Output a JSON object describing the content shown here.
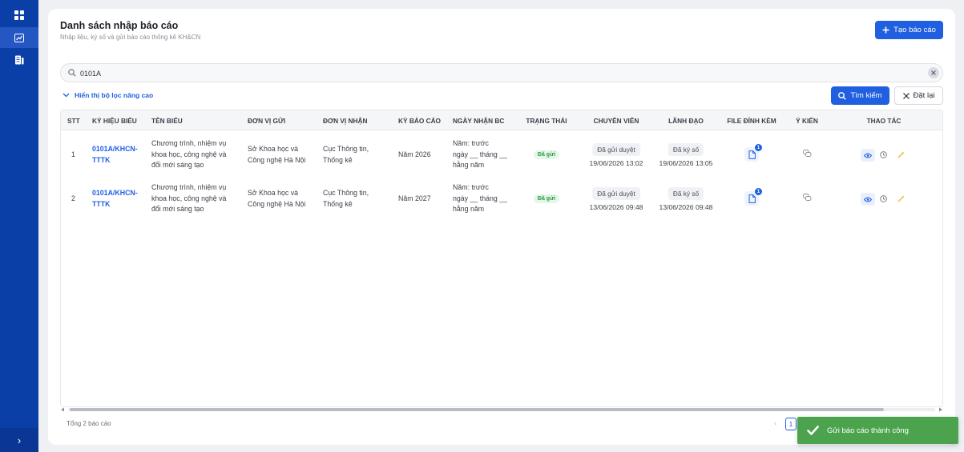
{
  "page": {
    "title": "Danh sách nhập báo cáo",
    "subtitle": "Nhập liệu, ký số và gửi báo cáo thống kê KH&CN",
    "create_label": "Tạo báo cáo"
  },
  "search": {
    "value": "0101A",
    "search_label": "Tìm kiếm",
    "reset_label": "Đặt lại",
    "advanced_label": "Hiển thị bộ lọc nâng cao"
  },
  "table": {
    "headers": [
      "STT",
      "KÝ HIỆU BIỂU",
      "TÊN BIỂU",
      "ĐƠN VỊ GỬI",
      "ĐƠN VỊ NHẬN",
      "KỲ BÁO CÁO",
      "NGÀY NHẬN BC",
      "TRẠNG THÁI",
      "CHUYÊN VIÊN",
      "LÃNH ĐẠO",
      "FILE ĐÍNH KÈM",
      "Ý KIẾN",
      "THAO TÁC"
    ],
    "rows": [
      {
        "stt": "1",
        "code_1": "0101A/KHCN-",
        "code_2": "TTTK",
        "name_1": "Chương trình, nhiệm vụ",
        "name_2": "khoa học, công nghệ và",
        "name_3": "đổi mới sáng tạo",
        "sender_1": "Sở Khoa học và",
        "sender_2": "Công nghệ Hà Nội",
        "receiver_1": "Cục Thông tin,",
        "receiver_2": "Thống kê",
        "period": "Năm 2026",
        "recv_1": "Năm: trước",
        "recv_2": "ngày __ tháng __",
        "recv_3": "hằng năm",
        "status": "Đã gửi",
        "specialist_status": "Đã gửi duyệt",
        "specialist_time": "19/06/2026 13:02",
        "leader_status": "Đã ký số",
        "leader_time": "19/06/2026 13:05",
        "file_count": "1"
      },
      {
        "stt": "2",
        "code_1": "0101A/KHCN-",
        "code_2": "TTTK",
        "name_1": "Chương trình, nhiệm vụ",
        "name_2": "khoa học, công nghệ và",
        "name_3": "đổi mới sáng tạo",
        "sender_1": "Sở Khoa học và",
        "sender_2": "Công nghệ Hà Nội",
        "receiver_1": "Cục Thông tin,",
        "receiver_2": "Thống kê",
        "period": "Năm 2027",
        "recv_1": "Năm: trước",
        "recv_2": "ngày __ tháng __",
        "recv_3": "hằng năm",
        "status": "Đã gửi",
        "specialist_status": "Đã gửi duyệt",
        "specialist_time": "13/06/2026 09:48",
        "leader_status": "Đã ký số",
        "leader_time": "13/06/2026 09:48",
        "file_count": "1"
      }
    ]
  },
  "footer": {
    "total": "Tổng 2 báo cáo",
    "prev": "‹",
    "current_page": "1"
  },
  "toast": {
    "message": "Gửi báo cáo thành công"
  },
  "sidebar": {
    "expand": "›"
  },
  "colors": {
    "primary": "#1f5fe0",
    "sidebar": "#0b3fa8",
    "success": "#4ca34e"
  },
  "icons": [
    "dashboard-icon",
    "chart-icon",
    "report-icon",
    "search-icon",
    "close-icon",
    "chevron-down-icon",
    "plus-icon",
    "file-icon",
    "comment-icon",
    "eye-icon",
    "clock-icon",
    "pencil-icon",
    "check-icon"
  ]
}
